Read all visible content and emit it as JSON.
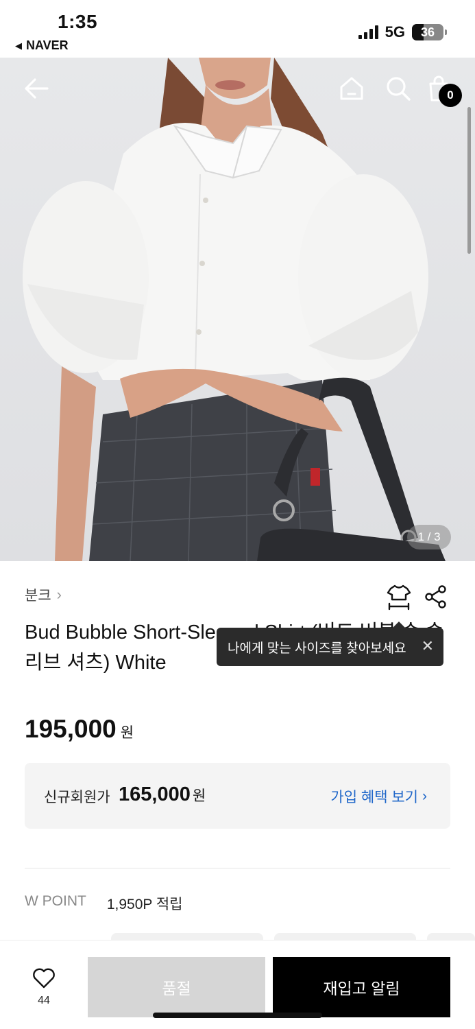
{
  "status_bar": {
    "time": "1:35",
    "back_app": "NAVER",
    "network": "5G",
    "battery": "36",
    "battery_level": 0.36
  },
  "product_gallery": {
    "pager": "1 / 3",
    "cart_count": "0",
    "icons": [
      "back-arrow-icon",
      "home-icon",
      "search-icon",
      "shopping-bag-icon"
    ]
  },
  "product": {
    "brand": "분크",
    "title": "Bud Bubble Short-Sleeved Shirt (버드 버블 숏 슬리브 셔츠) White",
    "price": "195,000",
    "currency": "원"
  },
  "tooltip": {
    "text": "나에게 맞는 사이즈를 찾아보세요"
  },
  "member_price": {
    "label": "신규회원가",
    "value": "165,000",
    "currency": "원",
    "link": "가입 혜택 보기"
  },
  "points": {
    "label": "W POINT",
    "value": "1,950P 적립"
  },
  "bottom_bar": {
    "wish_count": "44",
    "sold_out_label": "품절",
    "restock_label": "재입고 알림"
  },
  "colors": {
    "accent_link": "#1e66c9",
    "sold_out_bg": "#d6d6d6",
    "primary_button": "#000000"
  }
}
